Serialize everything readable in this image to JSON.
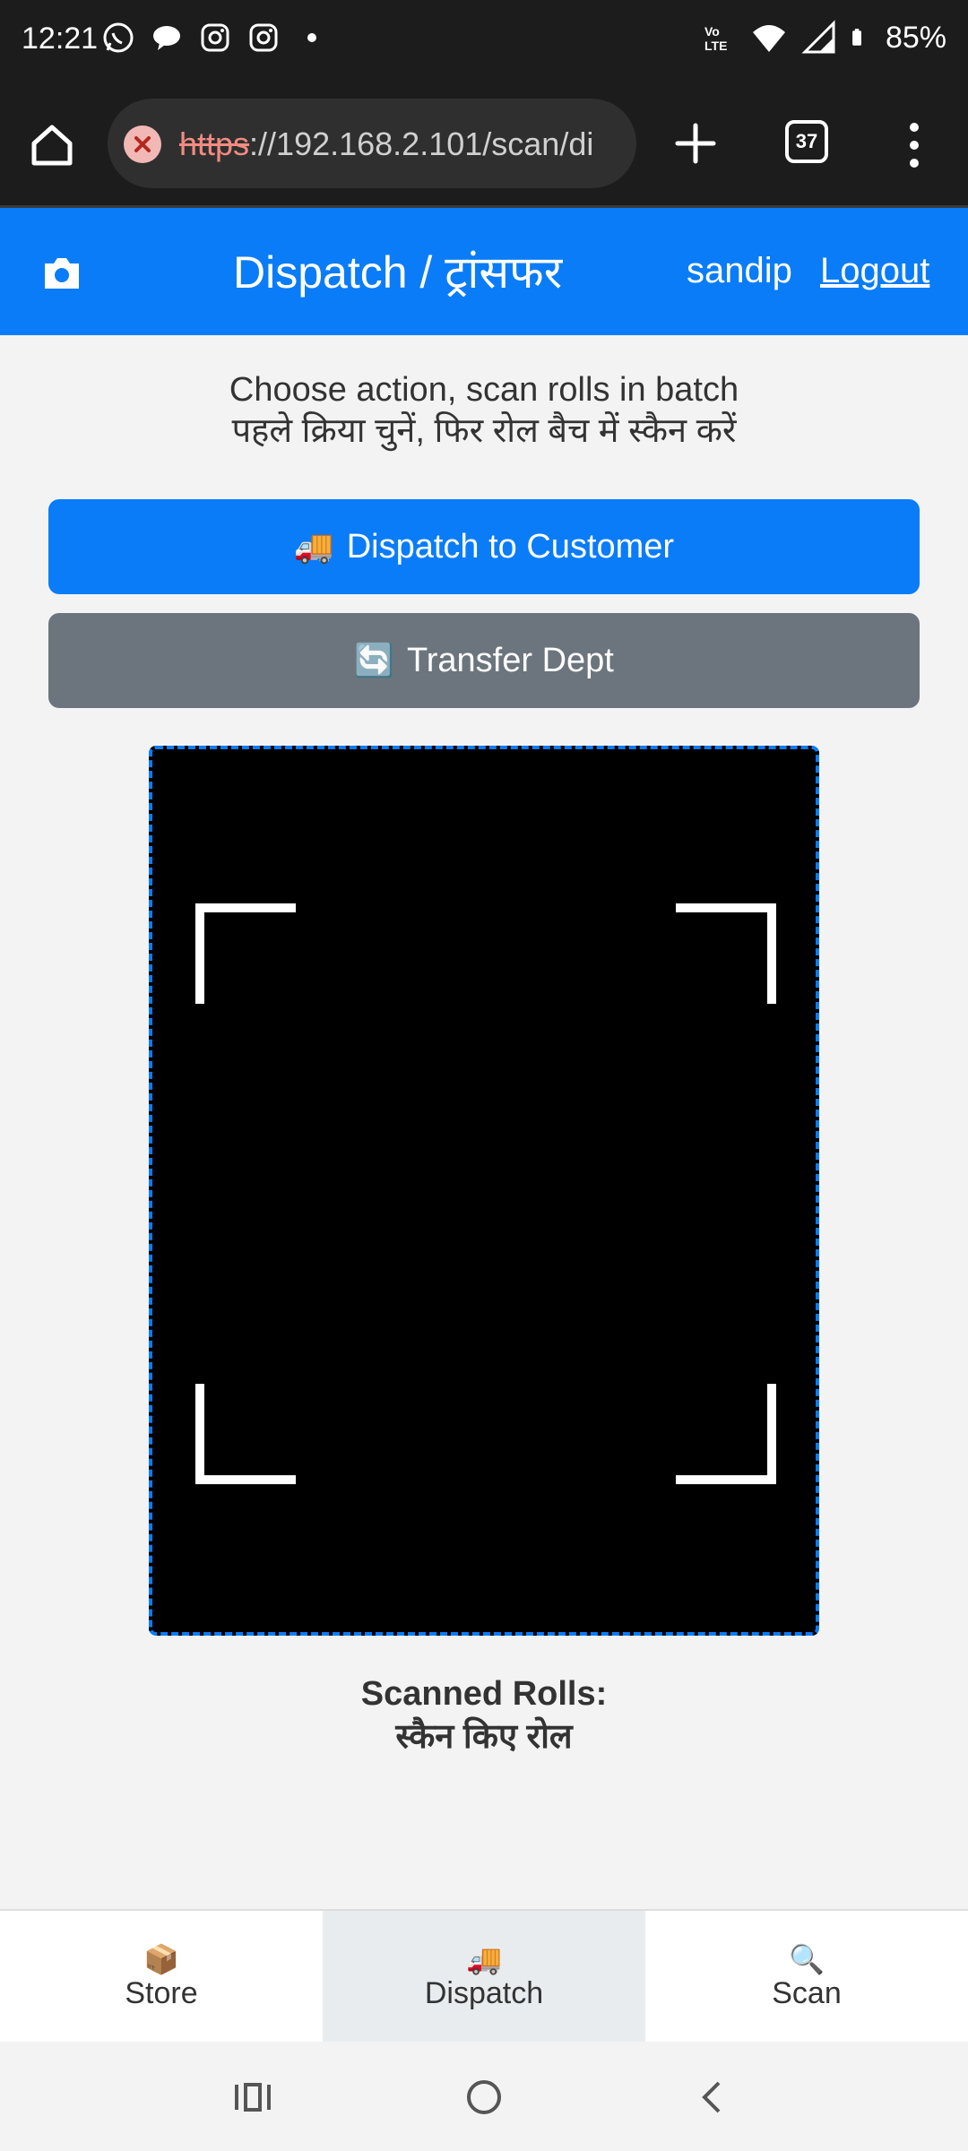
{
  "status_bar": {
    "time": "12:21",
    "battery": "85%",
    "left_icons": [
      "whatsapp-icon",
      "chat-bubble-icon",
      "instagram-icon",
      "instagram-icon",
      "dot-icon"
    ],
    "right_icons": [
      "volte-icon",
      "wifi-icon",
      "signal-icon",
      "battery-icon"
    ]
  },
  "browser": {
    "url_scheme": "https",
    "url_rest": "://192.168.2.101/scan/di",
    "tab_count": "37"
  },
  "header": {
    "title": "Dispatch / ट्रांसफर",
    "user": "sandip",
    "logout": "Logout",
    "color": "#0a7cf8"
  },
  "instructions": {
    "line1": "Choose action, scan rolls in batch",
    "line2": "पहले क्रिया चुनें, फिर रोल बैच में स्कैन करें"
  },
  "actions": {
    "dispatch": {
      "emoji": "🚚",
      "label": "Dispatch to Customer"
    },
    "transfer": {
      "emoji": "🔄",
      "label": "Transfer Dept"
    }
  },
  "scanned": {
    "line1": "Scanned Rolls:",
    "line2": "स्कैन किए रोल"
  },
  "bottom_nav": [
    {
      "emoji": "📦",
      "label": "Store",
      "active": false
    },
    {
      "emoji": "🚚",
      "label": "Dispatch",
      "active": true
    },
    {
      "emoji": "🔍",
      "label": "Scan",
      "active": false
    }
  ]
}
